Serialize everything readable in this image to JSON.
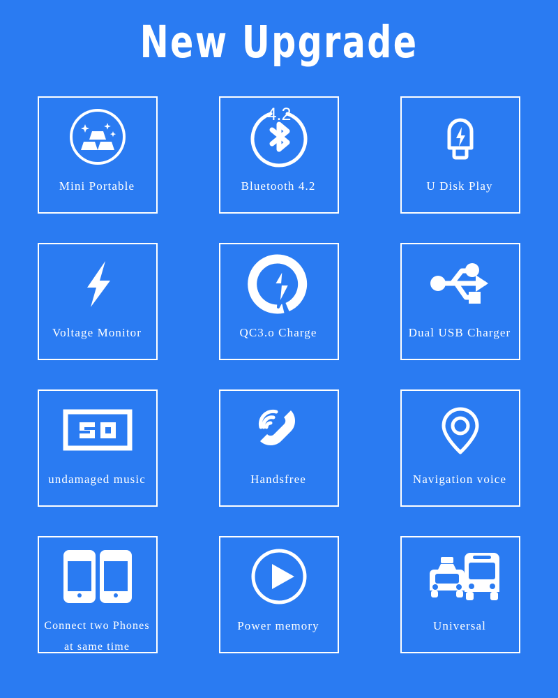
{
  "header": {
    "title": "New Upgrade"
  },
  "theme": {
    "background": "#2a7bf2",
    "foreground": "#ffffff",
    "card_border": "#ffffff"
  },
  "grid": {
    "columns": 3,
    "rows": 4,
    "cards": [
      {
        "id": "mini-portable",
        "icon": "gold-bars-circle-icon",
        "label": "Mini Portable"
      },
      {
        "id": "bluetooth",
        "icon": "bluetooth-icon",
        "icon_text": "4.2",
        "label": "Bluetooth 4.2"
      },
      {
        "id": "u-disk-play",
        "icon": "usb-flash-drive-icon",
        "label": "U Disk Play"
      },
      {
        "id": "voltage-monitor",
        "icon": "lightning-bolt-icon",
        "label": "Voltage Monitor"
      },
      {
        "id": "qc30-charge",
        "icon": "quick-charge-icon",
        "label": "QC3.o Charge"
      },
      {
        "id": "dual-usb-charger",
        "icon": "usb-trident-icon",
        "label": "Dual USB Charger"
      },
      {
        "id": "undamaged-music",
        "icon": "sq-badge-icon",
        "icon_text": "SQ",
        "label": "undamaged music"
      },
      {
        "id": "handsfree",
        "icon": "phone-handset-waves-icon",
        "label": "Handsfree"
      },
      {
        "id": "navigation-voice",
        "icon": "map-pin-icon",
        "label": "Navigation voice"
      },
      {
        "id": "connect-two-phones",
        "icon": "two-phones-icon",
        "label": "Connect two Phones",
        "label_line2": "at same time"
      },
      {
        "id": "power-memory",
        "icon": "play-circle-icon",
        "label": "Power memory"
      },
      {
        "id": "universal",
        "icon": "taxi-bus-icon",
        "label": "Universal"
      }
    ]
  }
}
